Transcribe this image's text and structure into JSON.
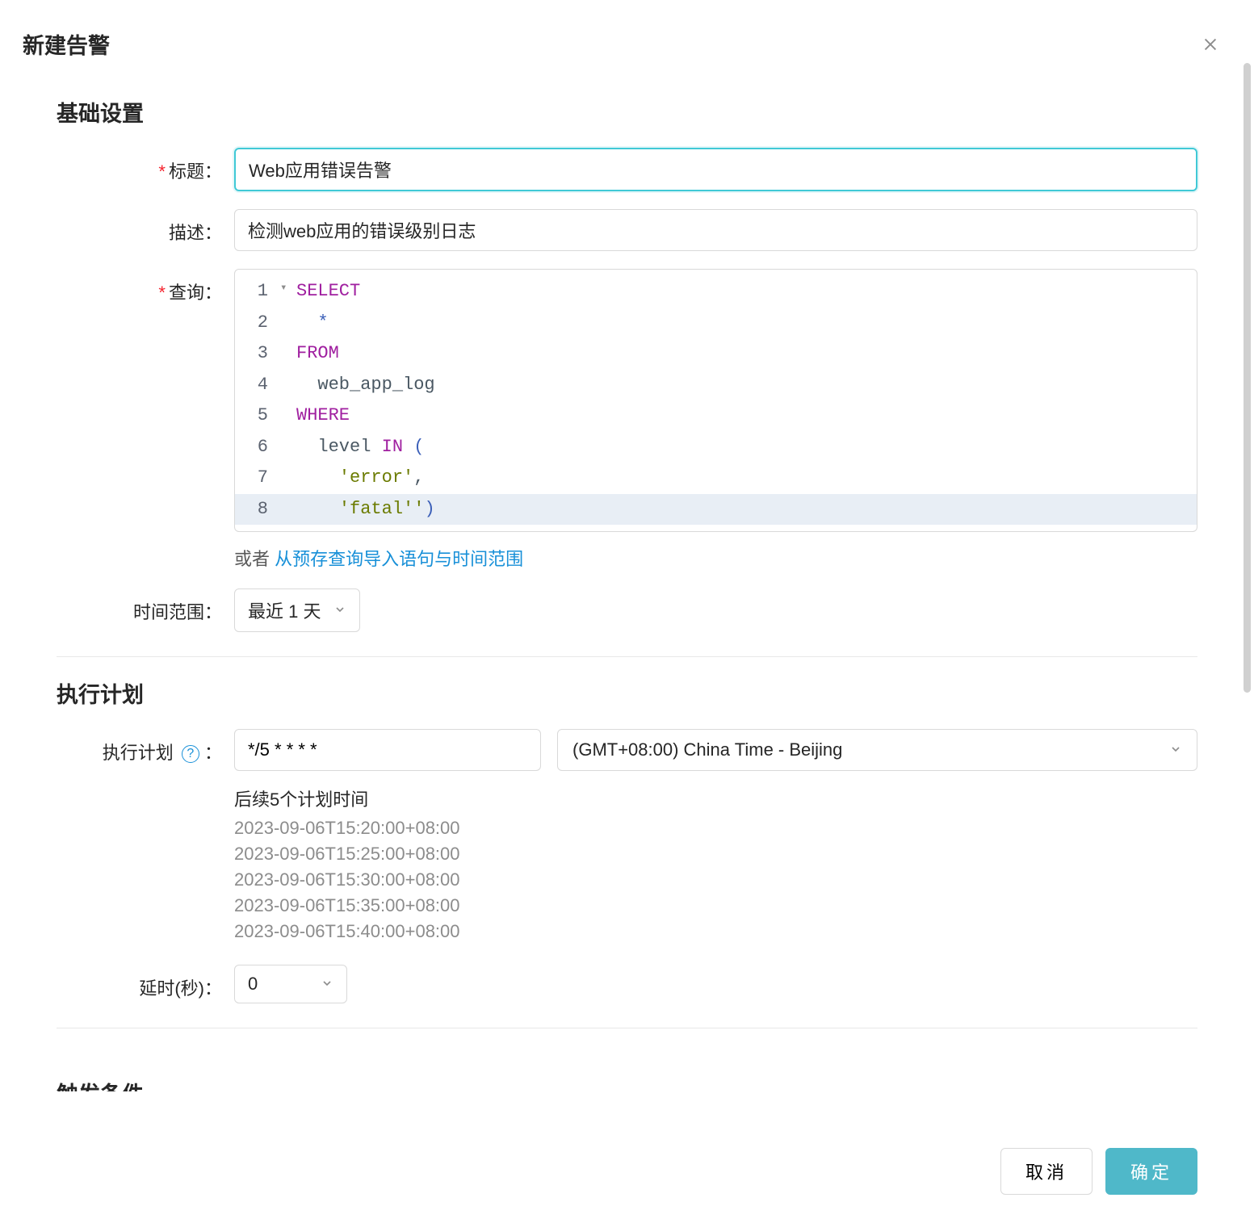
{
  "modal": {
    "title": "新建告警"
  },
  "basic": {
    "section_title": "基础设置",
    "title_label": "标题：",
    "title_value": "Web应用错误告警",
    "desc_label": "描述：",
    "desc_value": "检测web应用的错误级别日志",
    "query_label": "查询：",
    "query_lines": [
      {
        "n": "1",
        "tokens": [
          {
            "t": "SELECT",
            "c": "kw"
          }
        ]
      },
      {
        "n": "2",
        "tokens": [
          {
            "t": "  ",
            "c": ""
          },
          {
            "t": "*",
            "c": "blueop"
          }
        ]
      },
      {
        "n": "3",
        "tokens": [
          {
            "t": "FROM",
            "c": "kw"
          }
        ]
      },
      {
        "n": "4",
        "tokens": [
          {
            "t": "  web_app_log",
            "c": "ident"
          }
        ]
      },
      {
        "n": "5",
        "tokens": [
          {
            "t": "WHERE",
            "c": "kw"
          }
        ]
      },
      {
        "n": "6",
        "tokens": [
          {
            "t": "  level ",
            "c": "ident"
          },
          {
            "t": "IN",
            "c": "kw"
          },
          {
            "t": " ",
            "c": ""
          },
          {
            "t": "(",
            "c": "blueop"
          }
        ]
      },
      {
        "n": "7",
        "tokens": [
          {
            "t": "    ",
            "c": ""
          },
          {
            "t": "'error'",
            "c": "str"
          },
          {
            "t": ",",
            "c": "ident"
          }
        ]
      },
      {
        "n": "8",
        "tokens": [
          {
            "t": "    ",
            "c": ""
          },
          {
            "t": "'fatal'",
            "c": "str"
          },
          {
            "t": "'",
            "c": "str"
          },
          {
            "t": ")",
            "c": "blueop"
          }
        ]
      }
    ],
    "import_prefix": "或者 ",
    "import_link": "从预存查询导入语句与时间范围",
    "timerange_label": "时间范围：",
    "timerange_value": "最近 1 天"
  },
  "schedule": {
    "section_title": "执行计划",
    "label": "执行计划",
    "cron_value": "*/5 * * * *",
    "timezone_value": "(GMT+08:00) China Time - Beijing",
    "preview_title": "后续5个计划时间",
    "preview_times": [
      "2023-09-06T15:20:00+08:00",
      "2023-09-06T15:25:00+08:00",
      "2023-09-06T15:30:00+08:00",
      "2023-09-06T15:35:00+08:00",
      "2023-09-06T15:40:00+08:00"
    ],
    "delay_label": "延时(秒)：",
    "delay_value": "0"
  },
  "trigger": {
    "section_title": "触发条件"
  },
  "footer": {
    "cancel": "取消",
    "confirm": "确定"
  }
}
